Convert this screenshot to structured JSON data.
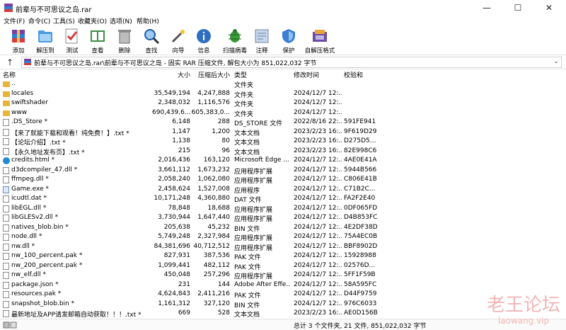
{
  "window": {
    "title": "前辈与不可思议之岛.rar",
    "minimize": "—",
    "maximize": "☐",
    "close": "✕"
  },
  "menu": [
    "文件(F)",
    "命令(C)",
    "工具(S)",
    "收藏夹(O)",
    "选项(N)",
    "帮助(H)"
  ],
  "toolbar": [
    {
      "label": "添加",
      "icon": "add-archive-icon"
    },
    {
      "label": "解压到",
      "icon": "extract-to-icon"
    },
    {
      "label": "测试",
      "icon": "test-icon"
    },
    {
      "label": "查看",
      "icon": "view-book-icon"
    },
    {
      "label": "删除",
      "icon": "trash-icon"
    },
    {
      "label": "查找",
      "icon": "magnifier-icon"
    },
    {
      "label": "向导",
      "icon": "wizard-wand-icon"
    },
    {
      "label": "信息",
      "icon": "info-icon"
    },
    {
      "label": "扫描病毒",
      "icon": "virus-scan-icon"
    },
    {
      "label": "注释",
      "icon": "comment-icon"
    },
    {
      "label": "保护",
      "icon": "shield-icon"
    },
    {
      "label": "自解压格式",
      "icon": "sfx-icon"
    }
  ],
  "path": {
    "text": "前辈与不可思议之岛.rar\\前辈与不可思议之岛 - 固实 RAR 压缩文件, 解包大小为 851,022,032 字节",
    "up": "↑",
    "dropdown": "⌄"
  },
  "columns": {
    "name": "名称",
    "size": "大小",
    "packed": "压缩后大小",
    "type": "类型",
    "modified": "修改时间",
    "crc": "校验和"
  },
  "files": [
    {
      "name": "..",
      "size": "",
      "packed": "",
      "type": "文件夹",
      "modified": "",
      "crc": "",
      "kind": "folder"
    },
    {
      "name": "locales",
      "size": "35,549,194",
      "packed": "4,247,888",
      "type": "文件夹",
      "modified": "2024/12/7 12:...",
      "crc": "",
      "kind": "folder"
    },
    {
      "name": "swiftshader",
      "size": "2,348,032",
      "packed": "1,116,576",
      "type": "文件夹",
      "modified": "2024/12/7 12:...",
      "crc": "",
      "kind": "folder"
    },
    {
      "name": "www",
      "size": "690,439,6...",
      "packed": "605,383,0...",
      "type": "文件夹",
      "modified": "2024/12/7 12:...",
      "crc": "",
      "kind": "folder"
    },
    {
      "name": ".DS_Store *",
      "size": "6,148",
      "packed": "288",
      "type": "DS_STORE 文件",
      "modified": "2022/8/16 22:...",
      "crc": "591FE941",
      "kind": "file"
    },
    {
      "name": "【来了就能下载和观看！纯免费！】.txt *",
      "size": "1,147",
      "packed": "1,200",
      "type": "文本文档",
      "modified": "2023/2/23 16:...",
      "crc": "9F619D29",
      "kind": "file"
    },
    {
      "name": "【论坛介绍】.txt *",
      "size": "1,138",
      "packed": "80",
      "type": "文本文档",
      "modified": "2023/2/23 16:...",
      "crc": "D275D5...",
      "kind": "file"
    },
    {
      "name": "【永久地址发布页】.txt *",
      "size": "215",
      "packed": "96",
      "type": "文本文档",
      "modified": "2023/2/23 16:...",
      "crc": "82E998C6",
      "kind": "file"
    },
    {
      "name": "credits.html *",
      "size": "2,016,436",
      "packed": "163,120",
      "type": "Microsoft Edge ...",
      "modified": "2024/12/7 12:...",
      "crc": "4AE0E41A",
      "kind": "edge"
    },
    {
      "name": "d3dcompiler_47.dll *",
      "size": "3,661,112",
      "packed": "1,673,232",
      "type": "应用程序扩展",
      "modified": "2024/12/7 12:...",
      "crc": "5944B566",
      "kind": "file"
    },
    {
      "name": "ffmpeg.dll *",
      "size": "2,058,240",
      "packed": "1,062,080",
      "type": "应用程序扩展",
      "modified": "2024/12/7 12:...",
      "crc": "C806E41B",
      "kind": "file"
    },
    {
      "name": "Game.exe *",
      "size": "2,458,624",
      "packed": "1,527,008",
      "type": "应用程序",
      "modified": "2024/12/7 12:...",
      "crc": "C71B2C...",
      "kind": "exe"
    },
    {
      "name": "icudtl.dat *",
      "size": "10,171,248",
      "packed": "4,360,880",
      "type": "DAT 文件",
      "modified": "2024/12/7 12:...",
      "crc": "FA2F2E40",
      "kind": "file"
    },
    {
      "name": "libEGL.dll *",
      "size": "78,848",
      "packed": "18,688",
      "type": "应用程序扩展",
      "modified": "2024/12/7 12:...",
      "crc": "0DF065FD",
      "kind": "file"
    },
    {
      "name": "libGLESv2.dll *",
      "size": "3,730,944",
      "packed": "1,647,440",
      "type": "应用程序扩展",
      "modified": "2024/12/7 12:...",
      "crc": "D4B853FC",
      "kind": "file"
    },
    {
      "name": "natives_blob.bin *",
      "size": "205,638",
      "packed": "45,232",
      "type": "BIN 文件",
      "modified": "2024/12/7 12:...",
      "crc": "4E2DF38D",
      "kind": "file"
    },
    {
      "name": "node.dll *",
      "size": "5,749,248",
      "packed": "2,327,984",
      "type": "应用程序扩展",
      "modified": "2024/12/7 12:...",
      "crc": "75A4EC0B",
      "kind": "file"
    },
    {
      "name": "nw.dll *",
      "size": "84,381,696",
      "packed": "40,712,512",
      "type": "应用程序扩展",
      "modified": "2024/12/7 12:...",
      "crc": "BBF8902D",
      "kind": "file"
    },
    {
      "name": "nw_100_percent.pak *",
      "size": "827,931",
      "packed": "387,536",
      "type": "PAK 文件",
      "modified": "2024/12/7 12:...",
      "crc": "15928988",
      "kind": "file"
    },
    {
      "name": "nw_200_percent.pak *",
      "size": "1,099,441",
      "packed": "482,112",
      "type": "PAK 文件",
      "modified": "2024/12/7 12:...",
      "crc": "02576D...",
      "kind": "file"
    },
    {
      "name": "nw_elf.dll *",
      "size": "450,048",
      "packed": "257,296",
      "type": "应用程序扩展",
      "modified": "2024/12/7 12:...",
      "crc": "5FF1F59B",
      "kind": "file"
    },
    {
      "name": "package.json *",
      "size": "231",
      "packed": "144",
      "type": "Adobe After Effe...",
      "modified": "2024/12/7 12:...",
      "crc": "58A595FC",
      "kind": "file"
    },
    {
      "name": "resources.pak *",
      "size": "4,624,843",
      "packed": "2,411,216",
      "type": "PAK 文件",
      "modified": "2024/12/7 12:...",
      "crc": "D44F9759",
      "kind": "file"
    },
    {
      "name": "snapshot_blob.bin *",
      "size": "1,161,312",
      "packed": "327,120",
      "type": "BIN 文件",
      "modified": "2024/12/7 12:...",
      "crc": "976C6033",
      "kind": "file"
    },
    {
      "name": "最新地址及APP请发邮箱自动获取！！！.txt *",
      "size": "669",
      "packed": "528",
      "type": "文本文档",
      "modified": "2023/2/23 16:...",
      "crc": "AE0D156B",
      "kind": "file"
    }
  ],
  "status": {
    "text": "总计 3 个文件夹, 21 文件, 851,022,032 字节"
  },
  "watermark": {
    "main": "老王论坛",
    "sub": "laowang.vip"
  }
}
